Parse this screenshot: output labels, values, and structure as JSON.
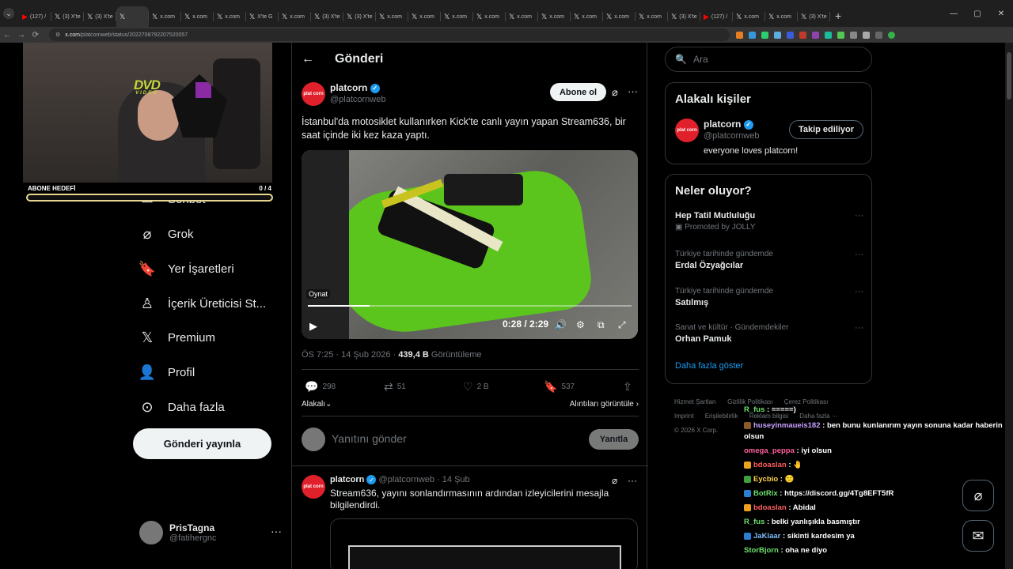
{
  "browser": {
    "tabs": [
      {
        "label": "(127) /",
        "icon": "youtube-icon"
      },
      {
        "label": "(3) X'te",
        "icon": "x-icon"
      },
      {
        "label": "(3) X'te",
        "icon": "x-icon"
      },
      {
        "label": "",
        "icon": "x-icon",
        "active": true
      },
      {
        "label": "x.com",
        "icon": "x-icon"
      },
      {
        "label": "x.com",
        "icon": "x-icon"
      },
      {
        "label": "x.com",
        "icon": "x-icon"
      },
      {
        "label": "X'te G",
        "icon": "x-icon"
      },
      {
        "label": "x.com",
        "icon": "x-icon"
      },
      {
        "label": "(3) X'te",
        "icon": "x-icon"
      },
      {
        "label": "(3) X'te",
        "icon": "x-icon"
      },
      {
        "label": "x.com",
        "icon": "x-icon"
      },
      {
        "label": "x.com",
        "icon": "x-icon"
      },
      {
        "label": "x.com",
        "icon": "x-icon"
      },
      {
        "label": "x.com",
        "icon": "x-icon"
      },
      {
        "label": "x.com",
        "icon": "x-icon"
      },
      {
        "label": "x.com",
        "icon": "x-icon"
      },
      {
        "label": "x.com",
        "icon": "x-icon"
      },
      {
        "label": "x.com",
        "icon": "x-icon"
      },
      {
        "label": "x.com",
        "icon": "x-icon"
      },
      {
        "label": "(3) X'te",
        "icon": "x-icon"
      },
      {
        "label": "(127) /",
        "icon": "youtube-icon"
      },
      {
        "label": "x.com",
        "icon": "x-icon"
      },
      {
        "label": "x.com",
        "icon": "x-icon"
      },
      {
        "label": "(3) X'te",
        "icon": "x-icon"
      }
    ],
    "url_host": "x.com",
    "url_path": "/platcornweb/status/2022708792207520057"
  },
  "stream": {
    "overlay_logo": "DVD",
    "overlay_logo_sub": "VIDEO",
    "goal_label": "ABONE HEDEFİ",
    "goal_value": "0  /  4"
  },
  "nav": {
    "items": [
      {
        "label": "Sohbet",
        "icon": "mail-icon"
      },
      {
        "label": "Grok",
        "icon": "grok-icon"
      },
      {
        "label": "Yer İşaretleri",
        "icon": "bookmark-icon"
      },
      {
        "label": "İçerik Üreticisi St...",
        "icon": "creator-studio-icon"
      },
      {
        "label": "Premium",
        "icon": "x-logo-icon"
      },
      {
        "label": "Profil",
        "icon": "profile-icon"
      },
      {
        "label": "Daha fazla",
        "icon": "more-circle-icon"
      }
    ],
    "post_button": "Gönderi yayınla",
    "account": {
      "name": "PrisTagna",
      "handle": "@fatihergnc"
    }
  },
  "main": {
    "header_title": "Gönderi",
    "tweet": {
      "avatar_text": "plat corn",
      "author": "platcorn",
      "handle": "@platcornweb",
      "follow_label": "Abone ol",
      "text": "İstanbul'da motosiklet kullanırken Kick'te canlı yayın yapan Stream636, bir saat içinde iki kez kaza yaptı.",
      "video": {
        "overlay_label": "Oynat",
        "time": "0:28 / 2:29",
        "progress": 0.19
      },
      "time": "ÖS 7:25 · 14 Şub 2026 · ",
      "views": "439,4 B",
      "views_label": " Görüntüleme",
      "replies": "298",
      "reposts": "51",
      "likes": "2 B",
      "bookmarks": "537",
      "sort_left": "Alakalı",
      "sort_right": "Alıntıları görüntüle"
    },
    "reply_box": {
      "placeholder": "Yanıtını gönder",
      "button": "Yanıtla"
    },
    "reply_tweet": {
      "author": "platcorn",
      "handle": "@platcornweb · 14 Şub",
      "text": "Stream636, yayını sonlandırmasının ardından izleyicilerini mesajla bilgilendirdi."
    }
  },
  "sidebar": {
    "search_placeholder": "Ara",
    "related_title": "Alakalı kişiler",
    "related_person": {
      "name": "platcorn",
      "handle": "@platcornweb",
      "bio": "everyone loves platcorn!",
      "button": "Takip ediliyor"
    },
    "trends_title": "Neler oluyor?",
    "trends": [
      {
        "context": "",
        "title": "Hep Tatil Mutluluğu",
        "promo": "Promoted by JOLLY"
      },
      {
        "context": "Türkiye tarihinde gündemde",
        "title": "Erdal Özyağcılar",
        "promo": ""
      },
      {
        "context": "Türkiye tarihinde gündemde",
        "title": "Satılmış",
        "promo": ""
      },
      {
        "context": "Sanat ve kültür · Gündemdekiler",
        "title": "Orhan Pamuk",
        "promo": ""
      }
    ],
    "show_more": "Daha fazla göster",
    "footer": [
      "Hizmet Şartları",
      "Gizlilik Politikası",
      "Çerez Politikası",
      "Imprint",
      "Erişilebilirlik",
      "Reklam bilgisi",
      "Daha fazla ···",
      "© 2026 X Corp."
    ]
  },
  "chat": [
    {
      "user": "R_fus",
      "text": " : =====)",
      "color": "#6ee06e",
      "badge": ""
    },
    {
      "user": "huseyinmaueis182",
      "text": " : ben bunu kunlanırım yayın sonuna kadar haberin",
      "color": "#c8a0ff",
      "badge": "#8b5a2b"
    },
    {
      "user": "",
      "text": "olsun",
      "color": "#ffffff",
      "badge": ""
    },
    {
      "user": "omega_peppa",
      "text": " : iyi olsun",
      "color": "#ff5f9e",
      "badge": ""
    },
    {
      "user": "bdoaslan",
      "text": " : ",
      "color": "#ff5f5f",
      "badge": "#f0a020"
    },
    {
      "user": "Eycbio",
      "text": " : ",
      "color": "#ffd24a",
      "badge": "#3fa03f"
    },
    {
      "user": "BotRix",
      "text": " : https://discord.gg/4Tg8EFT5fR",
      "color": "#6ee06e",
      "badge": "#2a7fd4"
    },
    {
      "user": "bdoaslan",
      "text": " : Abidal",
      "color": "#ff5f5f",
      "badge": "#f0a020"
    },
    {
      "user": "R_fus",
      "text": " : belki yanlışıkla basmıştır",
      "color": "#6ee06e",
      "badge": ""
    },
    {
      "user": "JaKlaar",
      "text": " : sikinti kardesim ya",
      "color": "#7fbfff",
      "badge": "#2a7fd4"
    },
    {
      "user": "StorBjorn",
      "text": " : oha ne diyo",
      "color": "#6ee06e",
      "badge": ""
    }
  ]
}
